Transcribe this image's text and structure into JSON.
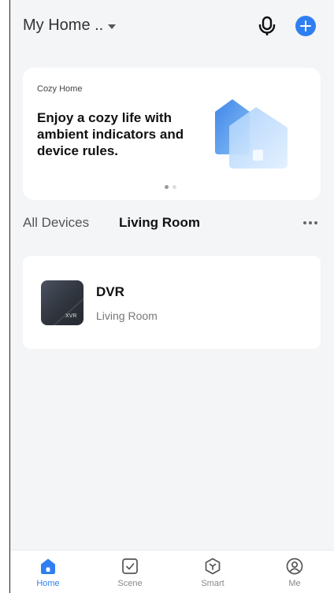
{
  "header": {
    "home_name": "My Home ..",
    "icons": {
      "dropdown": "caret-down-icon",
      "mic": "microphone-icon",
      "add": "plus-icon"
    }
  },
  "banner": {
    "subtitle": "Cozy Home",
    "title": "Enjoy a cozy life with ambient indicators and device rules.",
    "pagination": {
      "current": 1,
      "total": 2
    }
  },
  "room_tabs": {
    "items": [
      {
        "label": "All Devices",
        "active": false
      },
      {
        "label": "Living Room",
        "active": true
      }
    ],
    "more_icon": "more-horizontal-icon"
  },
  "devices": [
    {
      "name": "DVR",
      "room": "Living Room",
      "icon_badge": "XVR"
    }
  ],
  "tabbar": {
    "items": [
      {
        "label": "Home",
        "icon": "home-icon",
        "active": true
      },
      {
        "label": "Scene",
        "icon": "checkbox-icon",
        "active": false
      },
      {
        "label": "Smart",
        "icon": "cube-icon",
        "active": false
      },
      {
        "label": "Me",
        "icon": "user-icon",
        "active": false
      }
    ]
  },
  "colors": {
    "accent": "#2f7ff2",
    "background": "#f4f5f7",
    "card": "#ffffff",
    "text_primary": "#111111",
    "text_secondary": "#777777"
  }
}
